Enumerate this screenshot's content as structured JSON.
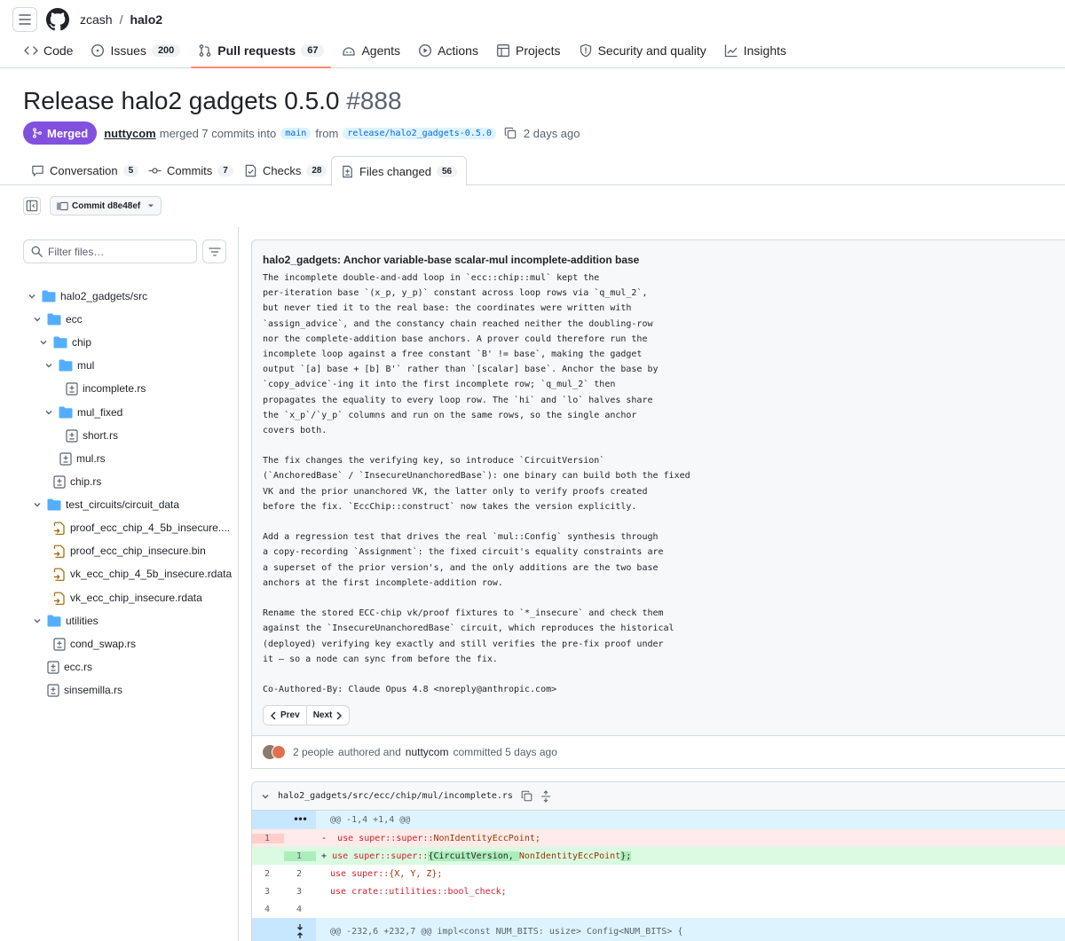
{
  "header": {
    "owner": "zcash",
    "separator": "/",
    "repo": "halo2"
  },
  "repo_nav": [
    {
      "label": "Code",
      "icon": "code-icon"
    },
    {
      "label": "Issues",
      "count": "200",
      "icon": "issue-icon"
    },
    {
      "label": "Pull requests",
      "count": "67",
      "icon": "pull-request-icon",
      "selected": true
    },
    {
      "label": "Agents",
      "icon": "agent-icon"
    },
    {
      "label": "Actions",
      "icon": "play-icon"
    },
    {
      "label": "Projects",
      "icon": "table-icon"
    },
    {
      "label": "Security and quality",
      "icon": "shield-icon"
    },
    {
      "label": "Insights",
      "icon": "graph-icon"
    }
  ],
  "pr": {
    "title": "Release halo2 gadgets 0.5.0",
    "number": "#888",
    "state": "Merged",
    "author": "nuttycom",
    "merged_text": "merged 7 commits into",
    "base_branch": "main",
    "from": "from",
    "head_branch": "release/halo2_gadgets-0.5.0",
    "time": "2 days ago"
  },
  "pr_tabs": [
    {
      "label": "Conversation",
      "count": "5"
    },
    {
      "label": "Commits",
      "count": "7"
    },
    {
      "label": "Checks",
      "count": "28"
    },
    {
      "label": "Files changed",
      "count": "56",
      "selected": true
    }
  ],
  "toolbar": {
    "commit_label": "Commit d8e48ef"
  },
  "sidebar": {
    "filter_placeholder": "Filter files…",
    "tree": [
      {
        "label": "halo2_gadgets/src",
        "type": "folder"
      },
      {
        "label": "ecc",
        "type": "folder"
      },
      {
        "label": "chip",
        "type": "folder"
      },
      {
        "label": "mul",
        "type": "folder"
      },
      {
        "label": "incomplete.rs",
        "type": "modified"
      },
      {
        "label": "mul_fixed",
        "type": "folder"
      },
      {
        "label": "short.rs",
        "type": "modified"
      },
      {
        "label": "mul.rs",
        "type": "modified"
      },
      {
        "label": "chip.rs",
        "type": "modified"
      },
      {
        "label": "test_circuits/circuit_data",
        "type": "folder"
      },
      {
        "label": "proof_ecc_chip_4_5b_insecure....",
        "type": "renamed"
      },
      {
        "label": "proof_ecc_chip_insecure.bin",
        "type": "renamed"
      },
      {
        "label": "vk_ecc_chip_4_5b_insecure.rdata",
        "type": "renamed"
      },
      {
        "label": "vk_ecc_chip_insecure.rdata",
        "type": "renamed"
      },
      {
        "label": "utilities",
        "type": "folder"
      },
      {
        "label": "cond_swap.rs",
        "type": "modified"
      },
      {
        "label": "ecc.rs",
        "type": "modified"
      },
      {
        "label": "sinsemilla.rs",
        "type": "modified"
      }
    ]
  },
  "commit": {
    "heading": "halo2_gadgets: Anchor variable-base scalar-mul incomplete-addition base",
    "lines": [
      "The incomplete double-and-add loop in `ecc::chip::mul` kept the",
      "per-iteration base `(x_p, y_p)` constant across loop rows via `q_mul_2`,",
      "but never tied it to the real base: the coordinates were written with",
      "`assign_advice`, and the constancy chain reached neither the doubling-row",
      "nor the complete-addition base anchors. A prover could therefore run the",
      "incomplete loop against a free constant `B' != base`, making the gadget",
      "output `[a] base + [b] B'` rather than `[scalar] base`. Anchor the base by",
      "`copy_advice`-ing it into the first incomplete row; `q_mul_2` then",
      "propagates the equality to every loop row. The `hi` and `lo` halves share",
      "the `x_p`/`y_p` columns and run on the same rows, so the single anchor",
      "covers both.",
      "",
      "The fix changes the verifying key, so introduce `CircuitVersion`",
      "(`AnchoredBase` / `InsecureUnanchoredBase`): one binary can build both the fixed",
      "VK and the prior unanchored VK, the latter only to verify proofs created",
      "before the fix. `EccChip::construct` now takes the version explicitly.",
      "",
      "Add a regression test that drives the real `mul::Config` synthesis through",
      "a copy-recording `Assignment`: the fixed circuit's equality constraints are",
      "a superset of the prior version's, and the only additions are the two base",
      "anchors at the first incomplete-addition row.",
      "",
      "Rename the stored ECC-chip vk/proof fixtures to `*_insecure` and check them",
      "against the `InsecureUnanchoredBase` circuit, which reproduces the historical",
      "(deployed) verifying key exactly and still verifies the pre-fix proof under",
      "it — so a node can sync from before the fix.",
      "",
      "Co-Authored-By: Claude Opus 4.8 <noreply@anthropic.com>"
    ],
    "prev_label": "Prev",
    "next_label": "Next",
    "people": "2 people",
    "authored_text": "authored and",
    "committer": "nuttycom",
    "committed_text": "committed 5 days ago"
  },
  "diff": {
    "file_path": "halo2_gadgets/src/ecc/chip/mul/incomplete.rs",
    "expand_label": "•••",
    "hunk1": "@@ -1,4 +1,4 @@",
    "lines": [
      {
        "kind": "del",
        "old": "1",
        "new": "",
        "sign": "-",
        "code": ""
      },
      {
        "kind": "add",
        "old": "",
        "new": "1",
        "sign": "+",
        "code": ""
      },
      {
        "kind": "ctx",
        "old": "2",
        "new": "2",
        "sign": "",
        "code": ""
      },
      {
        "kind": "ctx",
        "old": "3",
        "new": "3",
        "sign": "",
        "code": ""
      },
      {
        "kind": "ctx",
        "old": "4",
        "new": "4",
        "sign": "",
        "code": ""
      }
    ],
    "code": {
      "use": "use",
      "super_path": "super::super::",
      "nonidentity": "NonIdentityEccPoint;",
      "add_open": "{",
      "circuit_version": "CircuitVersion,",
      "nonidentity2": "NonIdentityEccPoint",
      "add_close": "};",
      "line2_path": "super::",
      "line2_items": "{X, Y, Z};",
      "line3_path": "crate::utilities::bool_check;"
    },
    "hunk2": "@@ -232,6 +232,7 @@ impl<const NUM_BITS: usize> Config<NUM_BITS> {"
  },
  "colors": {
    "merged": "#8250df",
    "accent_underline": "#fd8c73",
    "link": "#0969da"
  }
}
